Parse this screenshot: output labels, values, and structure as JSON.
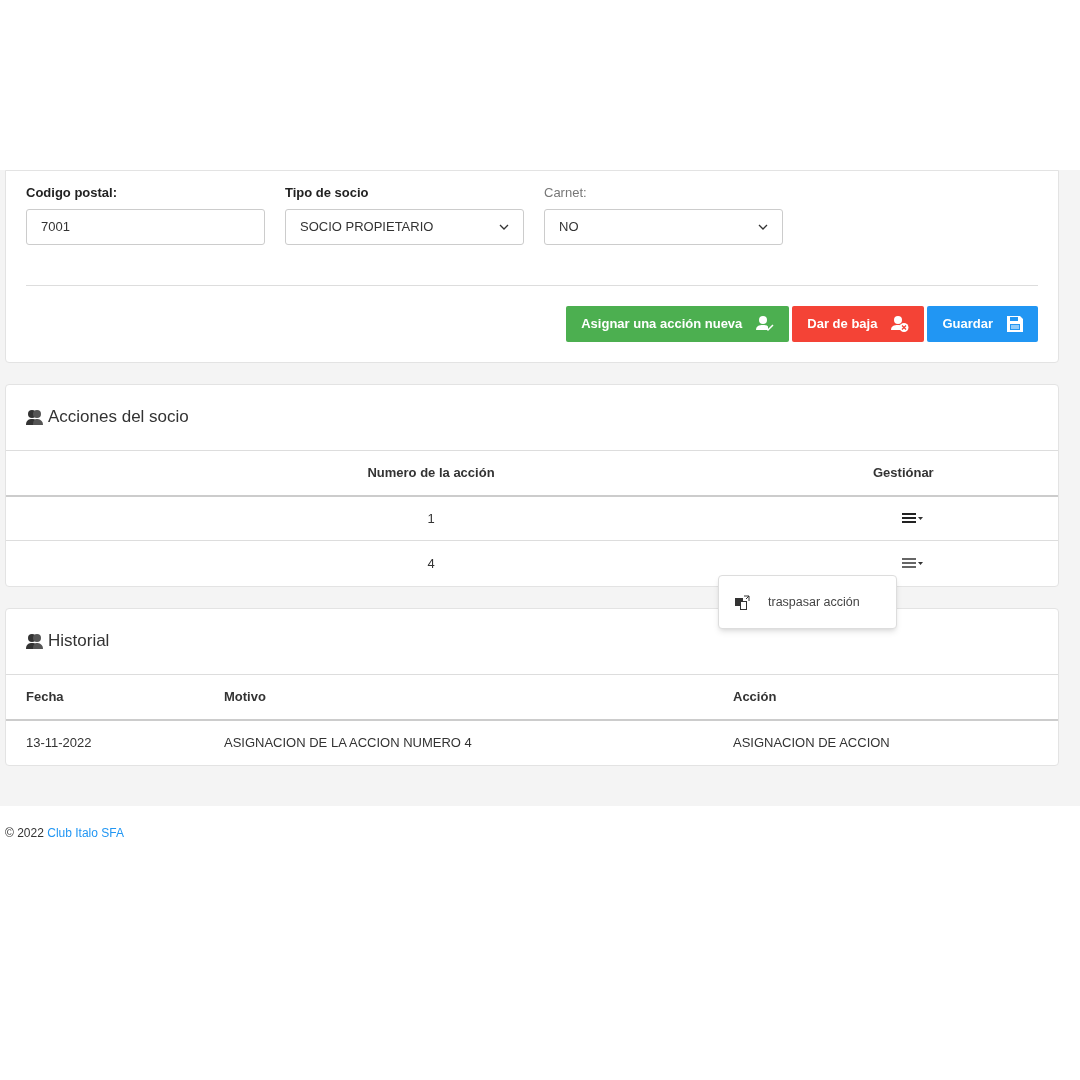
{
  "form": {
    "fields": [
      {
        "label": "Codigo postal:",
        "kind": "input",
        "value": "7001",
        "bold": true
      },
      {
        "label": "Tipo de socio",
        "kind": "select",
        "value": "SOCIO PROPIETARIO",
        "bold": true
      },
      {
        "label": "Carnet:",
        "kind": "select",
        "value": "NO",
        "bold": false
      }
    ],
    "buttons": [
      {
        "label": "Asignar una acción nueva",
        "kind": "assign"
      },
      {
        "label": "Dar de baja",
        "kind": "remove"
      },
      {
        "label": "Guardar",
        "kind": "save"
      }
    ]
  },
  "acciones": {
    "title": "Acciones del socio",
    "columns": [
      "Numero de la acción",
      "Gestiónar"
    ],
    "rows": [
      {
        "number": "1",
        "menu_open": false
      },
      {
        "number": "4",
        "menu_open": true
      }
    ],
    "menu": {
      "items": [
        "traspasar acción"
      ]
    }
  },
  "historial": {
    "title": "Historial",
    "columns": [
      "Fecha",
      "Motivo",
      "Acción"
    ],
    "rows": [
      [
        "13-11-2022",
        "ASIGNACION DE LA ACCION NUMERO 4",
        "ASIGNACION DE ACCION"
      ]
    ]
  },
  "footer": {
    "text": "© 2022",
    "link": "Club Italo SFA"
  }
}
